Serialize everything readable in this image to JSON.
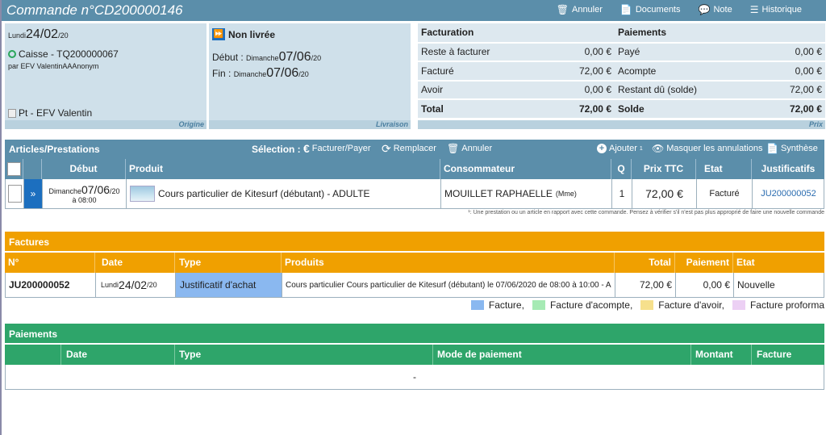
{
  "header": {
    "title": "Commande n°CD200000146",
    "actions": {
      "annuler": "Annuler",
      "documents": "Documents",
      "note": "Note",
      "historique": "Historique"
    }
  },
  "origine": {
    "day": "Lundi",
    "date": "24/02",
    "year": "/20",
    "caisse": "Caisse - TQ200000067",
    "par": "par EFV ValentinAAAnonym",
    "pt": "Pt - EFV Valentin",
    "footer": "Origine"
  },
  "livraison": {
    "status": "Non livrée",
    "debut_label": "Début :",
    "debut_day": "Dimanche",
    "debut_date": "07/06",
    "debut_year": "/20",
    "fin_label": "Fin :",
    "fin_day": "Dimanche",
    "fin_date": "07/06",
    "fin_year": "/20",
    "footer": "Livraison"
  },
  "facturation": {
    "title": "Facturation",
    "rows": [
      {
        "label": "Reste à facturer",
        "value": "0,00 €"
      },
      {
        "label": "Facturé",
        "value": "72,00 €"
      },
      {
        "label": "Avoir",
        "value": "0,00 €"
      },
      {
        "label": "Total",
        "value": "72,00 €"
      }
    ]
  },
  "paiements_summary": {
    "title": "Paiements",
    "rows": [
      {
        "label": "Payé",
        "value": "0,00 €"
      },
      {
        "label": "Acompte",
        "value": "0,00 €"
      },
      {
        "label": "Restant dû (solde)",
        "value": "72,00 €"
      },
      {
        "label": "Solde",
        "value": "72,00 €"
      }
    ],
    "footer": "Prix"
  },
  "articles": {
    "title": "Articles/Prestations",
    "selection_label": "Sélection :",
    "facturer": "Facturer/Payer",
    "remplacer": "Remplacer",
    "annuler": "Annuler",
    "ajouter": "Ajouter",
    "ajouter_sup": "1",
    "masquer": "Masquer les annulations",
    "synthese": "Synthèse",
    "columns": {
      "debut": "Début",
      "produit": "Produit",
      "consommateur": "Consommateur",
      "q": "Q",
      "prix": "Prix TTC",
      "etat": "Etat",
      "justificatifs": "Justificatifs"
    },
    "row": {
      "day": "Dimanche",
      "date": "07/06",
      "year": "/20",
      "time": "à 08:00",
      "produit": "Cours particulier de Kitesurf (débutant) - ADULTE",
      "consommateur": "MOUILLET RAPHAELLE",
      "civ": "(Mme)",
      "q": "1",
      "prix": "72,00 €",
      "etat": "Facturé",
      "justificatif": "JU200000052"
    },
    "note": "¹: Une prestation ou un article en rapport avec cette commande. Pensez à vérifier s'il n'est pas plus approprié de faire une nouvelle commande"
  },
  "factures": {
    "title": "Factures",
    "columns": {
      "num": "N°",
      "date": "Date",
      "type": "Type",
      "produits": "Produits",
      "total": "Total",
      "paiement": "Paiement",
      "etat": "Etat"
    },
    "row": {
      "num": "JU200000052",
      "day": "Lundi",
      "date": "24/02",
      "year": "/20",
      "type": "Justificatif d'achat",
      "produits": "Cours particulier Cours particulier de Kitesurf (débutant) le 07/06/2020 de 08:00 à 10:00 - A",
      "total": "72,00 €",
      "paiement": "0,00 €",
      "etat": "Nouvelle"
    },
    "legend": [
      {
        "label": "Facture,",
        "color": "#8ab8f0"
      },
      {
        "label": "Facture d'acompte,",
        "color": "#a6eab4"
      },
      {
        "label": "Facture d'avoir,",
        "color": "#f6e08c"
      },
      {
        "label": "Facture proforma",
        "color": "#ecd0f4"
      }
    ]
  },
  "paiements": {
    "title": "Paiements",
    "columns": {
      "date": "Date",
      "type": "Type",
      "mode": "Mode de paiement",
      "montant": "Montant",
      "facture": "Facture"
    },
    "empty": "-"
  }
}
